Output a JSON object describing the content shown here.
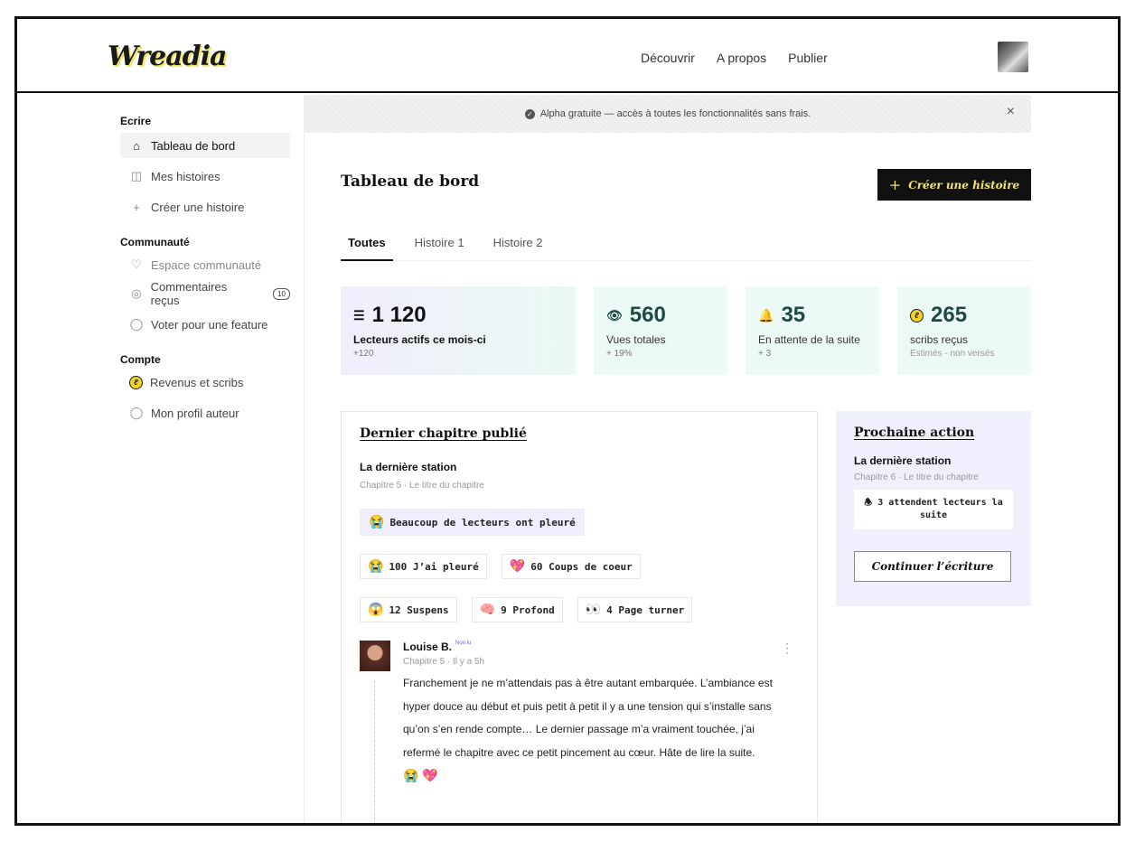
{
  "header": {
    "logo": "Wreadia",
    "nav": [
      "Découvrir",
      "A propos",
      "Publier"
    ]
  },
  "sidebar": {
    "sections": [
      {
        "title": "Ecrire"
      },
      {
        "title": "Communauté"
      },
      {
        "title": "Compte"
      }
    ],
    "items": [
      {
        "label": "Tableau de bord",
        "icon": "home-icon"
      },
      {
        "label": "Mes histoires",
        "icon": "book-icon"
      },
      {
        "label": "Créer une histoire",
        "icon": "plus-icon"
      },
      {
        "label": "Espace communauté",
        "icon": "heart-icon"
      },
      {
        "label": "Commentaires reçus",
        "icon": "chat-icon",
        "badge": "10"
      },
      {
        "label": "Voter pour une feature",
        "icon": "lightbulb-icon"
      },
      {
        "label": "Revenus et scribs",
        "icon": "coin-icon"
      },
      {
        "label": "Mon profil auteur",
        "icon": "user-icon"
      }
    ]
  },
  "banner": {
    "text": "Alpha gratuite — accès à toutes les fonctionnalités sans frais.",
    "close": "×"
  },
  "main": {
    "title": "Tableau de bord",
    "create_label": "Créer une histoire",
    "tabs": [
      "Toutes",
      "Histoire 1",
      "Histoire 2"
    ]
  },
  "stats": [
    {
      "value": "1 120",
      "label": "Lecteurs actifs ce mois-ci",
      "sub": "+120",
      "icon": "layers-icon"
    },
    {
      "value": "560",
      "label": "Vues totales",
      "sub": "+ 19%",
      "icon": "eye-icon"
    },
    {
      "value": "35",
      "label": "En attente de la suite",
      "sub": "+ 3",
      "icon": "bell-icon"
    },
    {
      "value": "265",
      "label": "scribs reçus",
      "sub": "Estimés - non versés",
      "icon": "coin-icon"
    }
  ],
  "chapter": {
    "title": "Dernier chapitre publié",
    "story": "La dernière station",
    "meta": "Chapitre 5 · Le titre du chapitre",
    "highlight": "Beaucoup de lecteurs ont pleuré",
    "reactions": [
      {
        "label": "100 J’ai pleuré",
        "emoji": "😭"
      },
      {
        "label": "60 Coups de coeur",
        "emoji": "💖"
      },
      {
        "label": "12 Suspens",
        "emoji": "😱"
      },
      {
        "label": "9 Profond",
        "emoji": "🧠"
      },
      {
        "label": "4 Page turner",
        "emoji": "👀"
      }
    ],
    "comment": {
      "name": "Louise B.",
      "tag": "Non lu",
      "meta": "Chapitre 5 · Il y a 5h",
      "text": "Franchement je ne m’attendais pas à être autant embarquée. L’ambiance est hyper douce au début et puis petit à petit il y a une tension qui s’installe sans qu’on s’en rende compte… Le dernier passage m’a vraiment touchée, j’ai refermé le chapitre avec ce petit pincement au cœur. Hâte de lire la suite.",
      "reactions": "😭 💖"
    }
  },
  "next_action": {
    "title": "Prochaine action",
    "story": "La dernière station",
    "meta": "Chapitre 6 · Le titre du chapitre",
    "waiting": "3 attendent lecteurs la suite",
    "button": "Continuer l’écriture"
  }
}
